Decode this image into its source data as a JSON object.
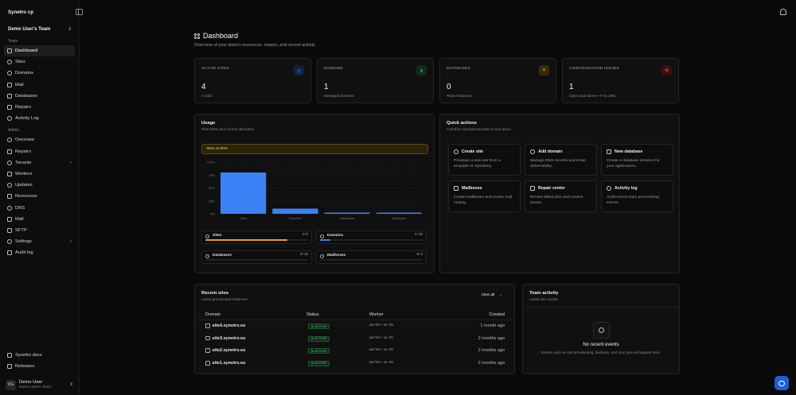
{
  "app": {
    "brand": "Synetro cp"
  },
  "team": {
    "name": "Demo User's Team"
  },
  "sidebar": {
    "team_section": "Team",
    "team_items": [
      {
        "label": "Dashboard",
        "icon": "dashboard-icon"
      },
      {
        "label": "Sites",
        "icon": "globe-icon"
      },
      {
        "label": "Domains",
        "icon": "network-icon"
      },
      {
        "label": "Mail",
        "icon": "mail-icon"
      },
      {
        "label": "Databases",
        "icon": "database-icon"
      },
      {
        "label": "Repairs",
        "icon": "wrench-icon"
      },
      {
        "label": "Activity Log",
        "icon": "history-icon"
      }
    ],
    "admin_section": "Admin",
    "admin_items": [
      {
        "label": "Overview",
        "icon": "compass-icon"
      },
      {
        "label": "Repairs",
        "icon": "wrench-icon"
      },
      {
        "label": "Tenants",
        "icon": "tenants-icon"
      },
      {
        "label": "Workers",
        "icon": "server-icon"
      },
      {
        "label": "Updates",
        "icon": "refresh-icon"
      },
      {
        "label": "Resources",
        "icon": "activity-icon"
      },
      {
        "label": "DNS",
        "icon": "network-icon"
      },
      {
        "label": "Mail",
        "icon": "mail-icon"
      },
      {
        "label": "SFTP",
        "icon": "terminal-icon"
      },
      {
        "label": "Settings",
        "icon": "gear-icon"
      },
      {
        "label": "Audit log",
        "icon": "clipboard-icon"
      }
    ],
    "footer_items": [
      {
        "label": "Synetro docs",
        "icon": "book-icon"
      },
      {
        "label": "Releases",
        "icon": "tag-icon"
      }
    ],
    "user": {
      "initials": "VG",
      "name": "Demo User",
      "team": "Demo User's Team"
    }
  },
  "header": {
    "title": "Dashboard",
    "subtitle": "Overview of your team's resources, repairs, and recent activity"
  },
  "stats": [
    {
      "label": "ACTIVE SITES",
      "value": "4",
      "sub": "4 total",
      "icon": "globe-icon",
      "color": "#3b82f6",
      "bg": "#102040"
    },
    {
      "label": "DOMAINS",
      "value": "1",
      "sub": "Managed domains",
      "icon": "network-icon",
      "color": "#22c55e",
      "bg": "#0f2e1a"
    },
    {
      "label": "DATABASES",
      "value": "0",
      "sub": "Team instances",
      "icon": "database-icon",
      "color": "#f59e0b",
      "bg": "#3a2a08"
    },
    {
      "label": "CONFIGURATION ISSUES",
      "value": "1",
      "sub": "Open team items • FAILURE",
      "icon": "wrench-icon",
      "color": "#ef4444",
      "bg": "#3a1010"
    }
  ],
  "usage": {
    "title": "Usage",
    "subtitle": "Plan limits and current allocation",
    "alert": "Sites at 80%",
    "meters": [
      {
        "label": "Sites",
        "value": "4/5",
        "fraction": 0.8,
        "color": "#f59e0b",
        "icon": "globe-icon"
      },
      {
        "label": "Domains",
        "value": "1/10",
        "fraction": 0.1,
        "color": "#3b82f6",
        "icon": "network-icon"
      },
      {
        "label": "Databases",
        "value": "0/10",
        "fraction": 0,
        "color": "#3b82f6",
        "icon": "database-icon"
      },
      {
        "label": "Mailboxes",
        "value": "0/3",
        "fraction": 0,
        "color": "#3b82f6",
        "icon": "mail-icon"
      }
    ]
  },
  "chart_data": {
    "type": "bar",
    "categories": [
      "Sites",
      "Domains",
      "Databases",
      "Mailboxes"
    ],
    "values": [
      80,
      10,
      0,
      0
    ],
    "ylim": [
      0,
      100
    ],
    "yticks": [
      "100%",
      "75%",
      "50%",
      "25%",
      "0%"
    ],
    "grid": true,
    "bar_color": "#3b82f6"
  },
  "quick_actions": {
    "title": "Quick actions",
    "subtitle": "Common operational tasks in one place.",
    "items": [
      {
        "title": "Create site",
        "desc": "Provision a new site from a template or repository.",
        "icon": "globe-icon"
      },
      {
        "title": "Add domain",
        "desc": "Manage DNS records and email deliverability.",
        "icon": "network-icon"
      },
      {
        "title": "New database",
        "desc": "Create a database instance for your applications.",
        "icon": "database-icon"
      },
      {
        "title": "Mailboxes",
        "desc": "Create mailboxes and review mail routing.",
        "icon": "mail-icon"
      },
      {
        "title": "Repair center",
        "desc": "Review failed jobs and runtime issues.",
        "icon": "wrench-icon"
      },
      {
        "title": "Activity log",
        "desc": "Audit recent team provisioning events.",
        "icon": "history-icon"
      }
    ]
  },
  "recent_sites": {
    "title": "Recent sites",
    "subtitle": "Latest provisioned instances",
    "view_all": "View all",
    "columns": [
      "Domain",
      "Status",
      "Worker",
      "Created"
    ],
    "rows": [
      {
        "domain": "site4.synetro.eu",
        "status": "ACTIVE",
        "worker": "worker-us-01",
        "created": "1 month ago"
      },
      {
        "domain": "site3.synetro.eu",
        "status": "ACTIVE",
        "worker": "worker-us-01",
        "created": "2 months ago"
      },
      {
        "domain": "site2.synetro.eu",
        "status": "ACTIVE",
        "worker": "worker-us-01",
        "created": "2 months ago"
      },
      {
        "domain": "site1.synetro.eu",
        "status": "ACTIVE",
        "worker": "worker-us-01",
        "created": "2 months ago"
      }
    ]
  },
  "team_activity": {
    "title": "Team activity",
    "subtitle": "Latest site events",
    "empty_title": "No recent events",
    "empty_desc": "Events such as site provisioning, backups, and cron jobs will appear here."
  }
}
